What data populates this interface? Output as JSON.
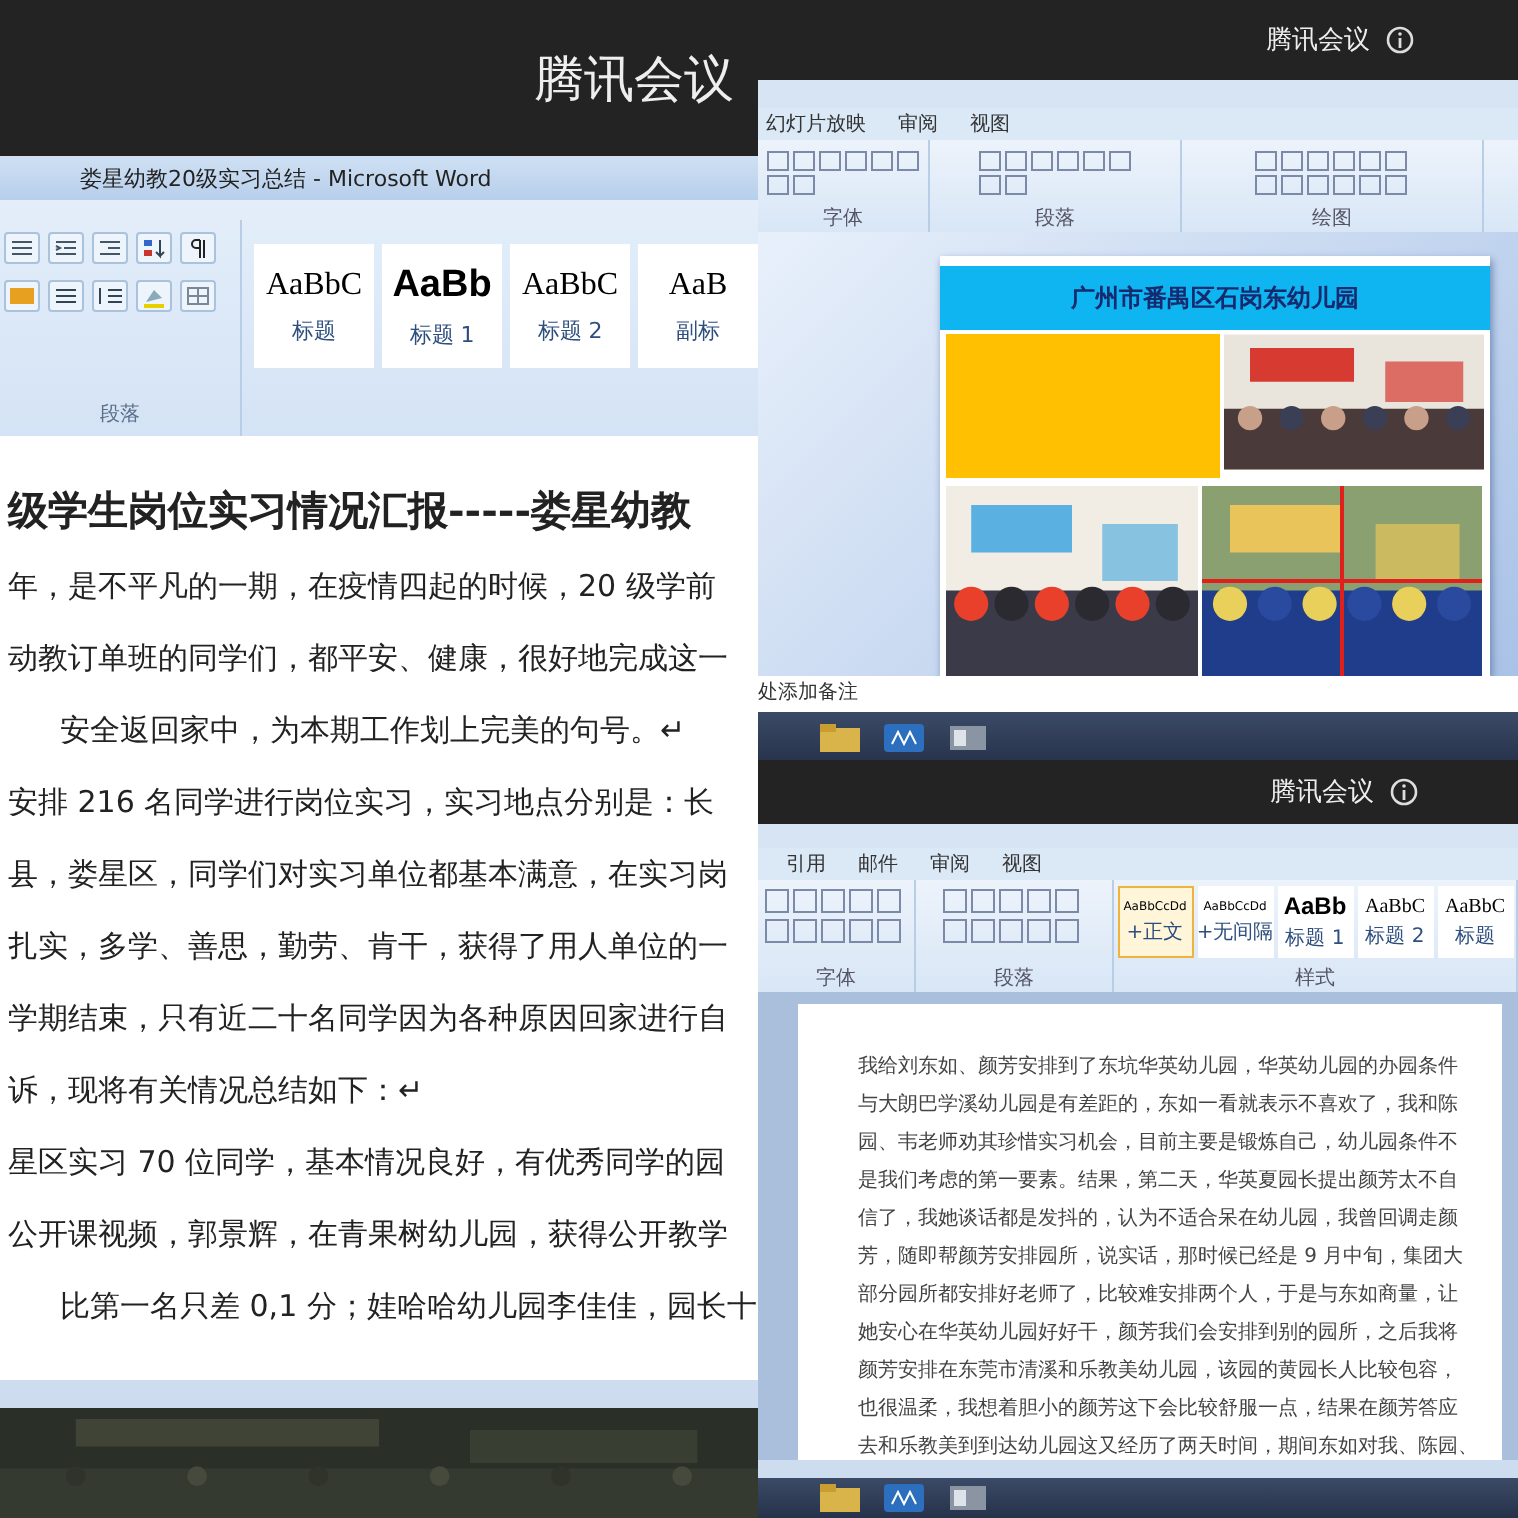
{
  "left_share": {
    "meeting_title": "腾讯会议",
    "window_title": "娄星幼教20级实习总结 - Microsoft Word",
    "ribbon": {
      "group_label": "段落",
      "styles": [
        {
          "sample": "AaBbC",
          "name": "标题",
          "kind": "serif"
        },
        {
          "sample": "AaBb",
          "name": "标题 1",
          "kind": "bold"
        },
        {
          "sample": "AaBbC",
          "name": "标题 2",
          "kind": "serif"
        },
        {
          "sample": "AaB",
          "name": "副标",
          "kind": "serif"
        }
      ]
    },
    "document": {
      "heading": "级学生岗位实习情况汇报-----娄星幼教",
      "lines": [
        {
          "text": "年，是不平凡的一期，在疫情四起的时候，20 级学前",
          "indent": false
        },
        {
          "text": "动教订单班的同学们，都平安、健康，很好地完成这一",
          "indent": false
        },
        {
          "text": "安全返回家中，为本期工作划上完美的句号。↵",
          "indent": true
        },
        {
          "text": "安排 216 名同学进行岗位实习，实习地点分别是：长",
          "indent": false
        },
        {
          "text": "县，娄星区，同学们对实习单位都基本满意，在实习岗",
          "indent": false
        },
        {
          "text": "扎实，多学、善思，勤劳、肯干，获得了用人单位的一",
          "indent": false
        },
        {
          "text": "学期结束，只有近二十名同学因为各种原因回家进行自",
          "indent": false
        },
        {
          "text": "诉，现将有关情况总结如下：↵",
          "indent": false
        },
        {
          "text": "星区实习 70 位同学，基本情况良好，有优秀同学的园",
          "indent": false
        },
        {
          "text": "公开课视频，郭景辉，在青果树幼儿园，获得公开教学",
          "indent": false
        },
        {
          "text": "比第一名只差 0,1 分；娃哈哈幼儿园李佳佳，园长十",
          "indent": true
        }
      ]
    }
  },
  "ppt_share": {
    "meeting_title": "腾讯会议",
    "tabs": [
      "幻灯片放映",
      "审阅",
      "视图"
    ],
    "groups": [
      "字体",
      "段落",
      "绘图"
    ],
    "slide": {
      "title": "广州市番禺区石岗东幼儿园"
    },
    "notes": "处添加备注"
  },
  "word_share": {
    "meeting_title": "腾讯会议",
    "tabs": [
      "引用",
      "邮件",
      "审阅",
      "视图"
    ],
    "groups": [
      "字体",
      "段落",
      "样式"
    ],
    "styles": [
      {
        "sample": "AaBbCcDd",
        "name": "+正文",
        "kind": "small",
        "selected": true
      },
      {
        "sample": "AaBbCcDd",
        "name": "+无间隔",
        "kind": "small",
        "selected": false
      },
      {
        "sample": "AaBb",
        "name": "标题 1",
        "kind": "bold",
        "selected": false
      },
      {
        "sample": "AaBbC",
        "name": "标题 2",
        "kind": "serif",
        "selected": false
      },
      {
        "sample": "AaBbC",
        "name": "标题",
        "kind": "serif",
        "selected": false
      }
    ],
    "document_lines": [
      "我给刘东如、颜芳安排到了东坑华英幼儿园，华英幼儿园的办园条件",
      "与大朗巴学溪幼儿园是有差距的，东如一看就表示不喜欢了，我和陈",
      "园、韦老师劝其珍惜实习机会，目前主要是锻炼自己，幼儿园条件不",
      "是我们考虑的第一要素。结果，第二天，华英夏园长提出颜芳太不自",
      "信了，我她谈话都是发抖的，认为不适合呆在幼儿园，我曾回调走颜",
      "芳，随即帮颜芳安排园所，说实话，那时候已经是 9 月中旬，集团大",
      "部分园所都安排好老师了，比较难安排两个人，于是与东如商量，让",
      "她安心在华英幼儿园好好干，颜芳我们会安排到别的园所，之后我将",
      "颜芳安排在东莞市清溪和乐教美幼儿园，该园的黄园长人比较包容，",
      "也很温柔，我想着胆小的颜芳这下会比较舒服一点，结果在颜芳答应",
      "去和乐教美到到达幼儿园这又经历了两天时间，期间东如对我、陈园、"
    ]
  }
}
